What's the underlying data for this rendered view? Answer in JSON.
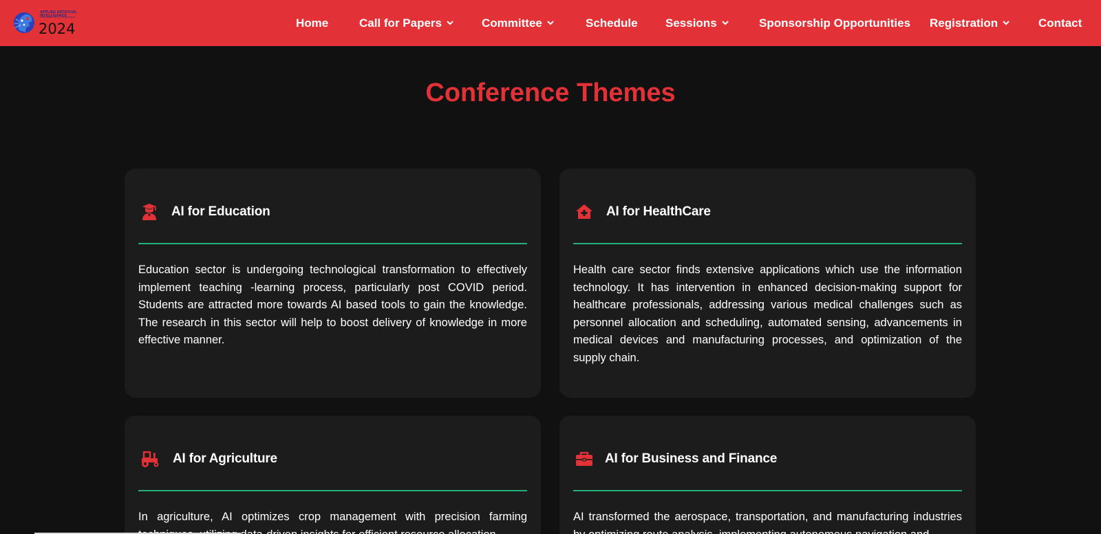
{
  "brand": {
    "logo_tagline": "APPLIED ARTIFICIAL INTELLIGENCE",
    "logo_subtag": "International Conference",
    "logo_year": "2024",
    "colors": {
      "primary": "#e23237",
      "accent_rule": "#23b07d",
      "background": "#111111",
      "card": "#1c1c1d"
    }
  },
  "nav": {
    "items": [
      {
        "label": "Home",
        "dropdown": false
      },
      {
        "label": "Call for Papers",
        "dropdown": true
      },
      {
        "label": "Committee",
        "dropdown": true
      },
      {
        "label": "Schedule",
        "dropdown": false
      },
      {
        "label": "Sessions",
        "dropdown": true
      },
      {
        "label": "Sponsorship Opportunities",
        "dropdown": false
      },
      {
        "label": "Registration",
        "dropdown": true
      },
      {
        "label": "Contact",
        "dropdown": false
      }
    ]
  },
  "main": {
    "title": "Conference Themes",
    "themes": [
      {
        "icon": "graduate-icon",
        "title": "AI for Education",
        "body": "Education sector is undergoing technological transformation to effectively implement teaching -learning process, particularly post COVID period. Students are attracted more towards AI based tools to gain the knowledge. The research in this sector will help to boost delivery of knowledge in more effective manner."
      },
      {
        "icon": "clinic-house-icon",
        "title": "AI for HealthCare",
        "body": "Health care sector finds extensive applications which use the information technology. It has intervention in enhanced decision-making support for healthcare professionals, addressing various medical challenges such as personnel allocation and scheduling, automated sensing, advancements in medical devices and manufacturing processes, and optimization of the supply chain."
      },
      {
        "icon": "tractor-icon",
        "title": "AI for Agriculture",
        "body": "In agriculture, AI optimizes crop management with precision farming techniques, utilizing data-driven insights for efficient resource allocation"
      },
      {
        "icon": "briefcase-icon",
        "title": "AI for Business and Finance",
        "body": "AI transformed the aerospace, transportation, and manufacturing industries by optimizing route analysis, implementing autonomous navigation and"
      }
    ]
  }
}
